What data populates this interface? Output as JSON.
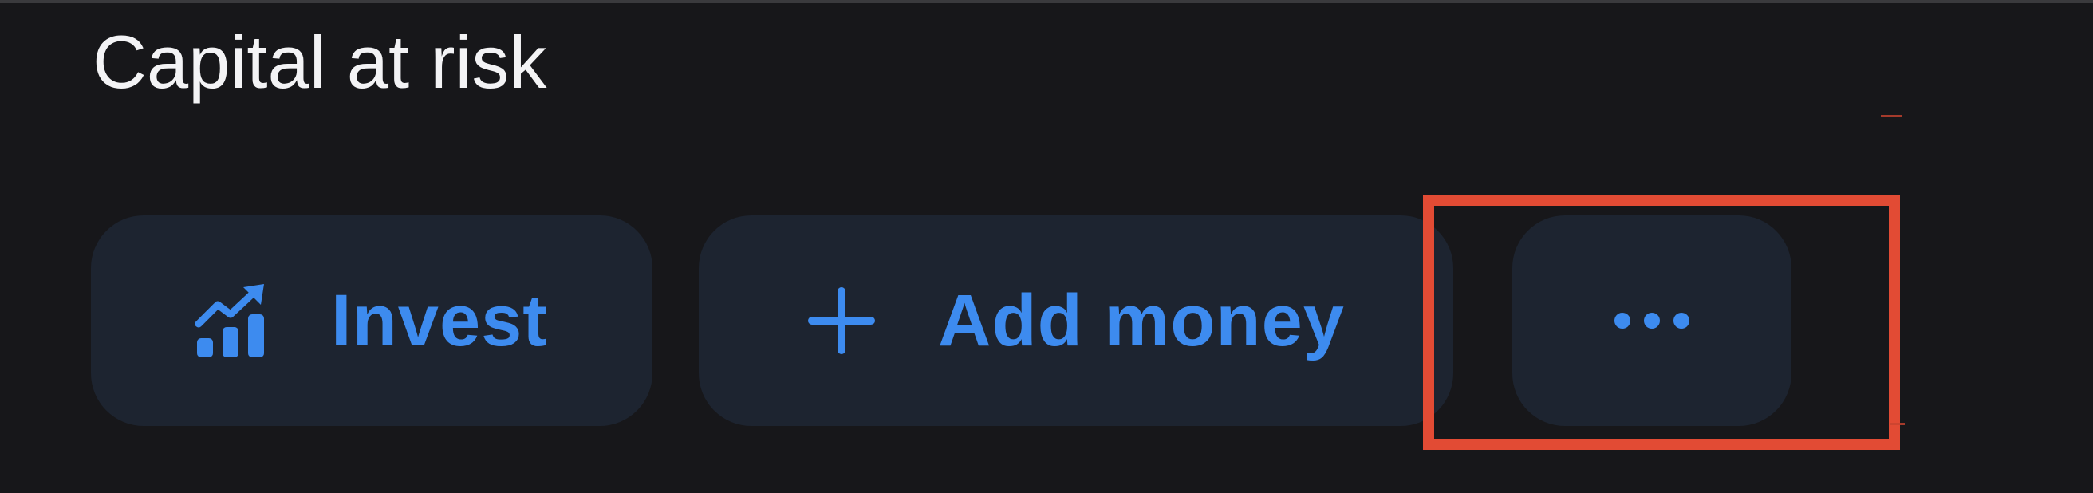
{
  "disclaimer": {
    "text": "Capital at risk"
  },
  "actions": {
    "invest": {
      "label": "Invest",
      "icon": "growth-chart-icon"
    },
    "add_money": {
      "label": "Add money",
      "icon": "plus-icon"
    },
    "more": {
      "icon": "more-dots-icon"
    }
  },
  "highlight": {
    "color": "#e24b34",
    "target": "more-button"
  },
  "colors": {
    "background": "#17171a",
    "button_background": "#1d2430",
    "accent": "#3d8bef",
    "text": "#f3f3f5"
  }
}
